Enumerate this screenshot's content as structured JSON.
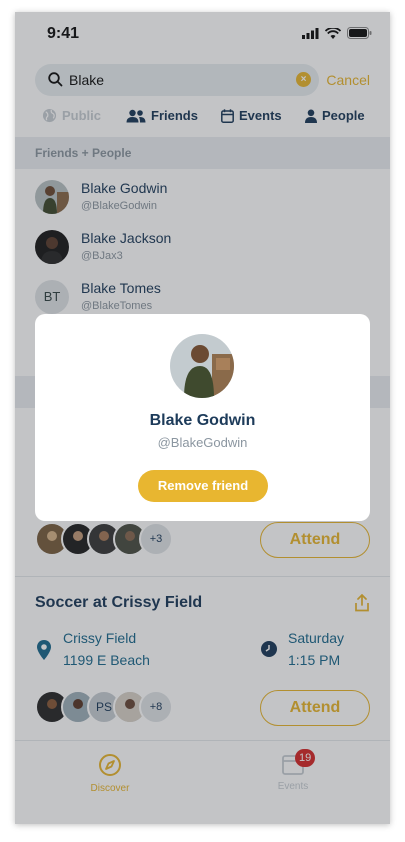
{
  "status_bar": {
    "time": "9:41"
  },
  "search": {
    "value": "Blake",
    "cancel_label": "Cancel"
  },
  "filters": {
    "public": "Public",
    "friends": "Friends",
    "events": "Events",
    "people": "People"
  },
  "section_header": "Friends + People",
  "people": [
    {
      "name": "Blake Godwin",
      "handle": "@BlakeGodwin"
    },
    {
      "name": "Blake Jackson",
      "handle": "@BJax3"
    },
    {
      "name": "Blake Tomes",
      "handle": "@BlakeTomes",
      "initials": "BT"
    }
  ],
  "event1": {
    "more_count": "+3",
    "attend_label": "Attend"
  },
  "event2": {
    "title": "Soccer at Crissy Field",
    "location_name": "Crissy Field",
    "location_address": "1199 E Beach",
    "day": "Saturday",
    "time": "1:15 PM",
    "initials": "PS",
    "more_count": "+8",
    "attend_label": "Attend"
  },
  "tabbar": {
    "discover": "Discover",
    "events": "Events",
    "events_badge": "19"
  },
  "modal": {
    "name": "Blake Godwin",
    "handle": "@BlakeGodwin",
    "remove_label": "Remove friend"
  },
  "colors": {
    "accent": "#e8b630",
    "navy": "#1d3b5a",
    "link": "#1d6a8e",
    "badge": "#d62a2a"
  }
}
